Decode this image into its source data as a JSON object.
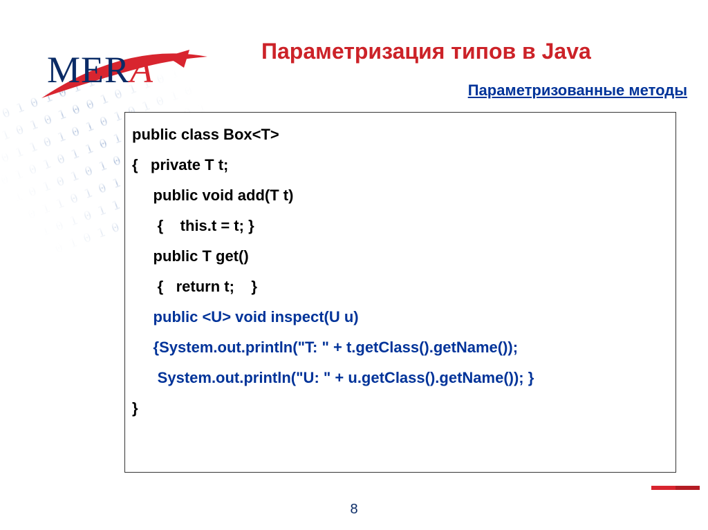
{
  "logo": {
    "text_left": "MER",
    "text_right": "A"
  },
  "title": "Параметризация типов в Java",
  "subtitle": "Параметризованные методы",
  "code": {
    "l1": "public class Box<T>",
    "l2": "{   private T t;",
    "l3": "     public void add(T t)",
    "l4": "      {    this.t = t; }",
    "l5": "     public T get()",
    "l6": "      {   return t;    }",
    "l7a": "     public ",
    "l7b": "<U>",
    "l7c": " void inspect(U u)",
    "l8": "     {System.out.println(\"T: \" + t.getClass().getName());",
    "l9": "      System.out.println(\"U: \" + u.getClass().getName()); }",
    "l10": "}"
  },
  "page_number": "8"
}
